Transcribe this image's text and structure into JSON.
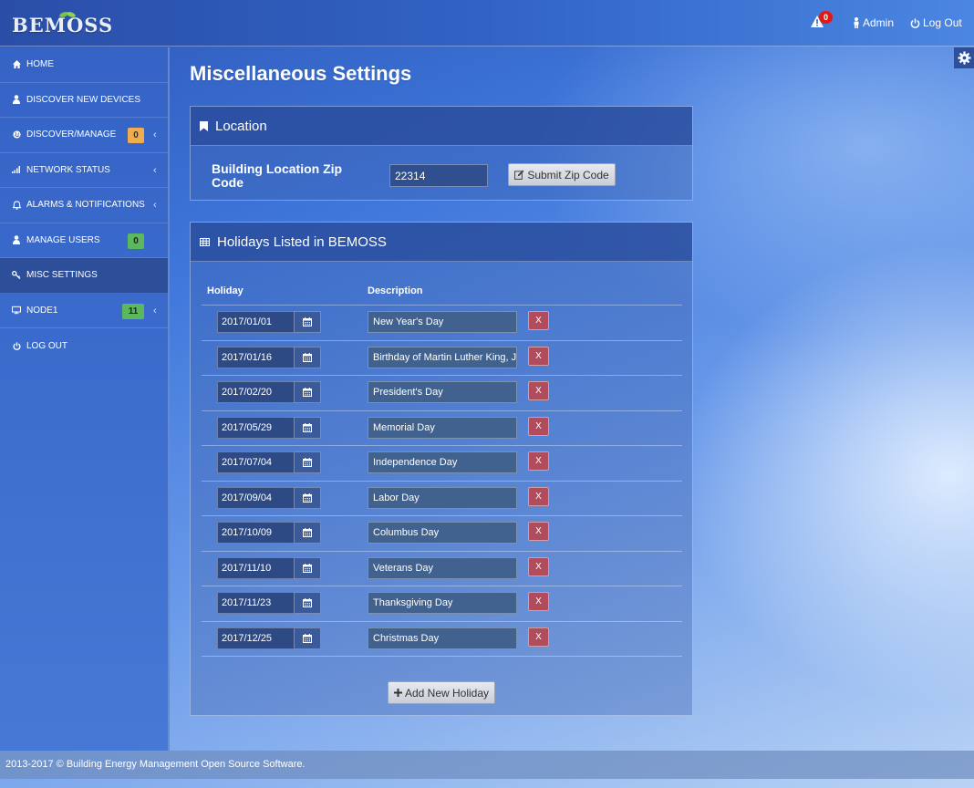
{
  "header": {
    "logo": "BEMOSS",
    "alert_count": "0",
    "admin_label": "Admin",
    "logout_label": "Log Out"
  },
  "sidebar": {
    "items": [
      {
        "label": "HOME",
        "icon": "home-icon"
      },
      {
        "label": "DISCOVER NEW DEVICES",
        "icon": "user-icon"
      },
      {
        "label": "DISCOVER/MANAGE",
        "icon": "globe-icon",
        "badge": "0",
        "badge_color": "#f0ad4e"
      },
      {
        "label": "NETWORK STATUS",
        "icon": "signal-icon"
      },
      {
        "label": "ALARMS & NOTIFICATIONS",
        "icon": "bell-icon"
      },
      {
        "label": "MANAGE USERS",
        "icon": "user-icon",
        "badge": "0",
        "badge_color": "#5cb85c"
      },
      {
        "label": "MISC SETTINGS",
        "icon": "key-icon"
      },
      {
        "label": "NODE1",
        "icon": "monitor-icon",
        "badge": "11",
        "badge_color": "#5cb85c"
      },
      {
        "label": "LOG OUT",
        "icon": "power-icon"
      }
    ]
  },
  "main": {
    "title": "Miscellaneous Settings",
    "location": {
      "heading": "Location",
      "zip_label": "Building Location Zip Code",
      "zip_value": "22314",
      "submit_label": "Submit Zip Code"
    },
    "holidays": {
      "heading": "Holidays Listed in BEMOSS",
      "col_holiday": "Holiday",
      "col_description": "Description",
      "delete_label": "X",
      "rows": [
        {
          "date": "2017/01/01",
          "description": "New Year's Day"
        },
        {
          "date": "2017/01/16",
          "description": "Birthday of Martin Luther King, Jr."
        },
        {
          "date": "2017/02/20",
          "description": "President's Day"
        },
        {
          "date": "2017/05/29",
          "description": "Memorial Day"
        },
        {
          "date": "2017/07/04",
          "description": "Independence Day"
        },
        {
          "date": "2017/09/04",
          "description": "Labor Day"
        },
        {
          "date": "2017/10/09",
          "description": "Columbus Day"
        },
        {
          "date": "2017/11/10",
          "description": "Veterans Day"
        },
        {
          "date": "2017/11/23",
          "description": "Thanksgiving Day"
        },
        {
          "date": "2017/12/25",
          "description": "Christmas Day"
        }
      ],
      "add_label": "Add New Holiday"
    }
  },
  "footer": {
    "text": "2013-2017 © Building Energy Management Open Source Software."
  }
}
